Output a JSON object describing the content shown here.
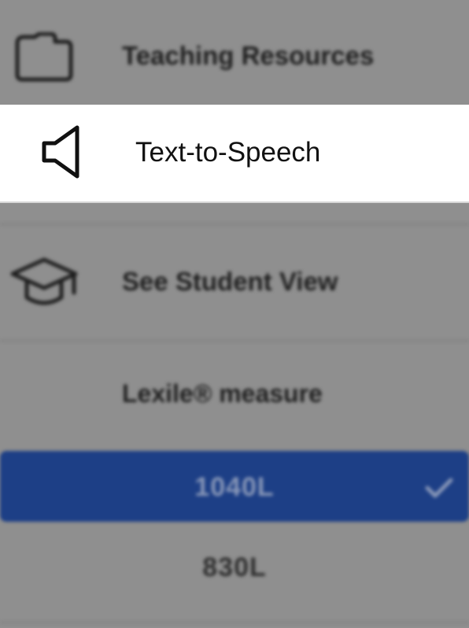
{
  "menu": {
    "teaching_resources": {
      "label": "Teaching Resources",
      "icon": "folder-icon"
    },
    "text_to_speech": {
      "label": "Text-to-Speech",
      "icon": "speaker-icon"
    },
    "student_view": {
      "label": "See Student View",
      "icon": "graduation-cap-icon"
    }
  },
  "lexile": {
    "heading": "Lexile® measure",
    "levels": [
      {
        "label": "1040L",
        "selected": true
      },
      {
        "label": "830L",
        "selected": false
      }
    ]
  },
  "colors": {
    "overlay": "#8f8f8f",
    "selected_bg": "#1d3f86",
    "focus_bg": "#ffffff"
  }
}
